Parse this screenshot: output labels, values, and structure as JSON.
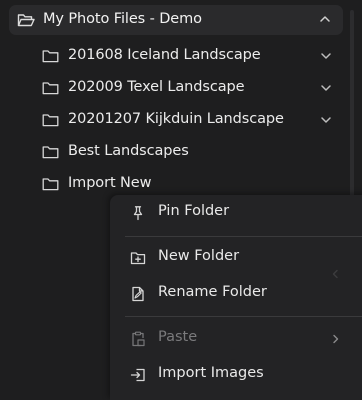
{
  "tree": {
    "root": {
      "label": "My Photo Files - Demo",
      "icon": "folder-open-icon",
      "expanded": true
    },
    "children": [
      {
        "label": "201608 Iceland Landscape",
        "icon": "folder-icon",
        "has_children": true
      },
      {
        "label": "202009 Texel Landscape",
        "icon": "folder-icon",
        "has_children": true
      },
      {
        "label": "20201207 Kijkduin Landscape",
        "icon": "folder-icon",
        "has_children": true
      },
      {
        "label": "Best Landscapes",
        "icon": "folder-icon",
        "has_children": false
      },
      {
        "label": "Import New",
        "icon": "folder-icon",
        "has_children": false
      }
    ]
  },
  "context_menu": {
    "items": [
      {
        "label": "Pin Folder",
        "icon": "pin-icon",
        "enabled": true
      },
      {
        "label": "New Folder",
        "icon": "folder-plus-icon",
        "enabled": true
      },
      {
        "label": "Rename Folder",
        "icon": "rename-icon",
        "enabled": true
      },
      {
        "label": "Paste",
        "icon": "paste-icon",
        "enabled": false,
        "submenu": true
      },
      {
        "label": "Import Images",
        "icon": "import-icon",
        "enabled": true
      }
    ]
  },
  "colors": {
    "background": "#1e1e1f",
    "menu_background": "#232325",
    "selected_row": "#2a2a2c",
    "text": "#ececec",
    "disabled_text": "#7a7a7c"
  }
}
